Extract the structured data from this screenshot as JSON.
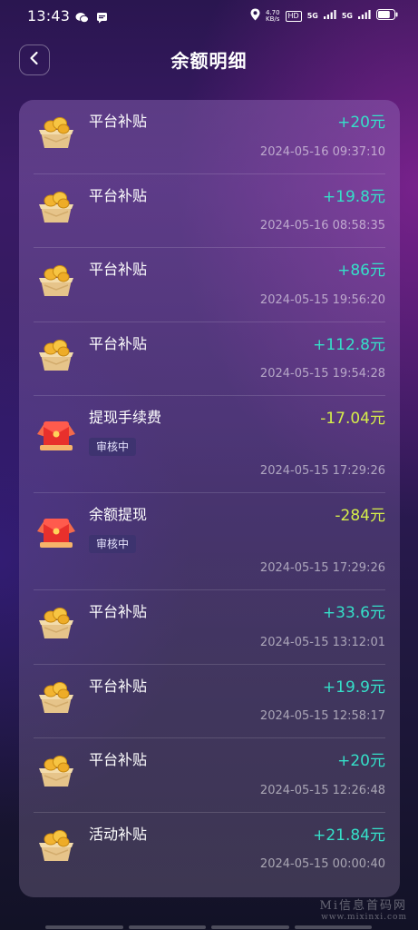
{
  "status_bar": {
    "time": "13:43",
    "net_speed_value": "4.70",
    "net_speed_unit": "KB/s",
    "hd": "HD",
    "sim1": "5G",
    "sim2": "5G",
    "battery_level": 0.75
  },
  "header": {
    "title": "余额明细"
  },
  "records": [
    {
      "title": "平台补贴",
      "amount": "+20元",
      "time": "2024-05-16 09:37:10",
      "kind": "coin",
      "sign": "plus",
      "tag": ""
    },
    {
      "title": "平台补贴",
      "amount": "+19.8元",
      "time": "2024-05-16 08:58:35",
      "kind": "coin",
      "sign": "plus",
      "tag": ""
    },
    {
      "title": "平台补贴",
      "amount": "+86元",
      "time": "2024-05-15 19:56:20",
      "kind": "coin",
      "sign": "plus",
      "tag": ""
    },
    {
      "title": "平台补贴",
      "amount": "+112.8元",
      "time": "2024-05-15 19:54:28",
      "kind": "coin",
      "sign": "plus",
      "tag": ""
    },
    {
      "title": "提现手续费",
      "amount": "-17.04元",
      "time": "2024-05-15 17:29:26",
      "kind": "envelope",
      "sign": "minus",
      "tag": "审核中"
    },
    {
      "title": "余额提现",
      "amount": "-284元",
      "time": "2024-05-15 17:29:26",
      "kind": "envelope",
      "sign": "minus",
      "tag": "审核中"
    },
    {
      "title": "平台补贴",
      "amount": "+33.6元",
      "time": "2024-05-15 13:12:01",
      "kind": "coin",
      "sign": "plus",
      "tag": ""
    },
    {
      "title": "平台补贴",
      "amount": "+19.9元",
      "time": "2024-05-15 12:58:17",
      "kind": "coin",
      "sign": "plus",
      "tag": ""
    },
    {
      "title": "平台补贴",
      "amount": "+20元",
      "time": "2024-05-15 12:26:48",
      "kind": "coin",
      "sign": "plus",
      "tag": ""
    },
    {
      "title": "活动补贴",
      "amount": "+21.84元",
      "time": "2024-05-15 00:00:40",
      "kind": "coin",
      "sign": "plus",
      "tag": ""
    }
  ],
  "watermark": {
    "line1": "Mi信息首码网",
    "line2": "www.mixinxi.com"
  },
  "colors": {
    "plus": "#35e0c9",
    "minus": "#d6ee4a"
  }
}
